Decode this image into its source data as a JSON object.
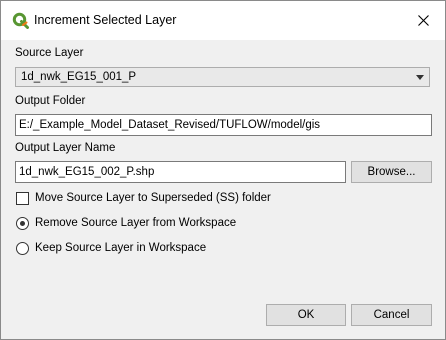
{
  "window": {
    "title": "Increment Selected Layer",
    "app_icon": "qgis-icon",
    "close_icon": "close-icon"
  },
  "source_layer": {
    "label": "Source Layer",
    "selected": "1d_nwk_EG15_001_P",
    "dropdown_icon": "chevron-down-icon"
  },
  "output_folder": {
    "label": "Output Folder",
    "value": "E:/_Example_Model_Dataset_Revised/TUFLOW/model/gis"
  },
  "output_layer_name": {
    "label": "Output Layer Name",
    "value": "1d_nwk_EG15_002_P.shp",
    "browse_label": "Browse..."
  },
  "options": {
    "move_to_superseded": {
      "label": "Move Source Layer to Superseded (SS) folder",
      "checked": false
    },
    "remove_source": {
      "label": "Remove Source Layer from Workspace",
      "selected": true
    },
    "keep_source": {
      "label": "Keep Source Layer in Workspace",
      "selected": false
    }
  },
  "buttons": {
    "ok_label": "OK",
    "cancel_label": "Cancel"
  },
  "colors": {
    "qgis_green": "#589632",
    "qgis_yellow": "#ee7913"
  }
}
